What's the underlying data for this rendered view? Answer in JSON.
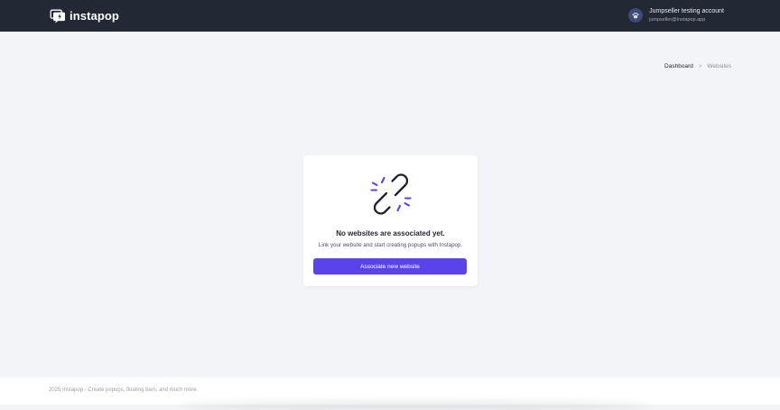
{
  "app": {
    "brand_name": "instapop",
    "brand_color": "#5b43ec",
    "topbar_color": "#222834"
  },
  "account": {
    "name": "Jumpseller testing account",
    "email": "jumpseller@instapop.app",
    "avatar_icon": "paw-icon"
  },
  "breadcrumb": {
    "items": [
      {
        "label": "Dashboard"
      },
      {
        "label": "Websites"
      }
    ],
    "separator": ">"
  },
  "empty_state": {
    "icon": "broken-link-icon",
    "title": "No websites are associated yet.",
    "message": "Link your website and start creating popups with Instapop.",
    "button_label": "Associate new website"
  },
  "footer": {
    "text": "2025 Instapop - Create popups, floating bars, and much more."
  }
}
